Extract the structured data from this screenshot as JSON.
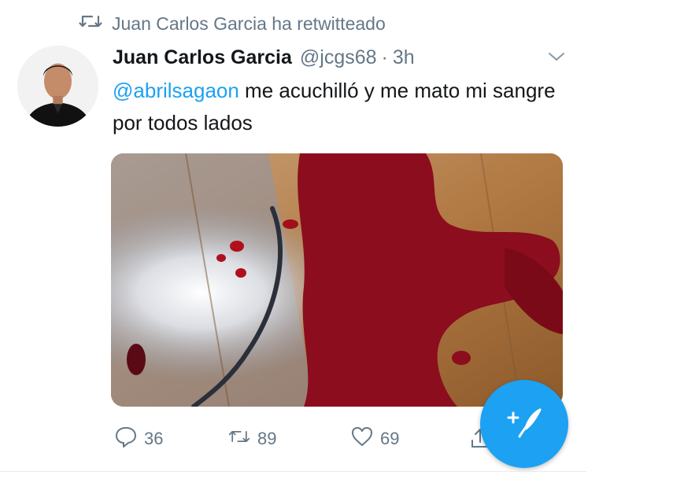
{
  "retweet_banner": {
    "icon": "retweet-icon",
    "text": "Juan Carlos Garcia ha retwitteado"
  },
  "tweet": {
    "author_name": "Juan Carlos Garcia",
    "handle": "@jcgs68",
    "separator": "·",
    "time": "3h",
    "text_mention": "@abrilsagaon",
    "text_body": " me acuchilló y me mato mi sangre por todos lados",
    "media_alt_icon": "photo-image"
  },
  "actions": {
    "reply_count": "36",
    "retweet_count": "89",
    "like_count": "69"
  },
  "fab": {
    "icon": "compose-tweet-icon"
  },
  "colors": {
    "accent": "#1da1f2",
    "muted": "#657786",
    "text": "#14171a"
  }
}
